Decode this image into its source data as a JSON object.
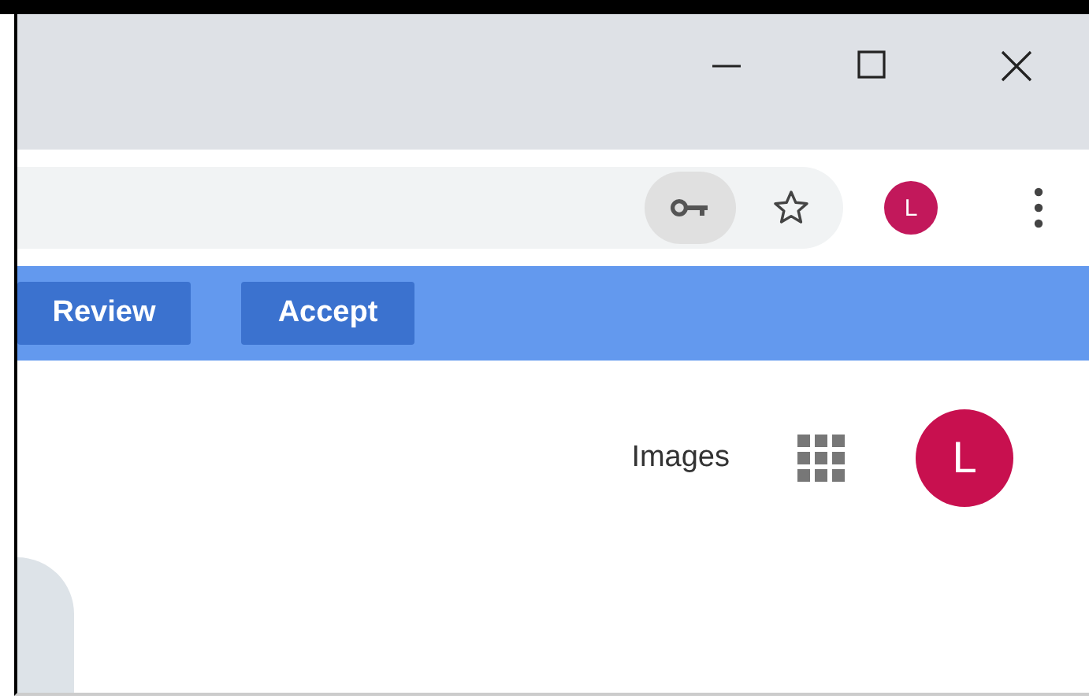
{
  "window": {
    "controls": [
      {
        "kind": "minimize"
      },
      {
        "kind": "maximize"
      },
      {
        "kind": "close"
      }
    ]
  },
  "toolbar": {
    "profile_initial": "L"
  },
  "infobar": {
    "buttons": [
      "Review",
      "Accept"
    ]
  },
  "page": {
    "header_link": "Images",
    "account_initial": "L"
  }
}
